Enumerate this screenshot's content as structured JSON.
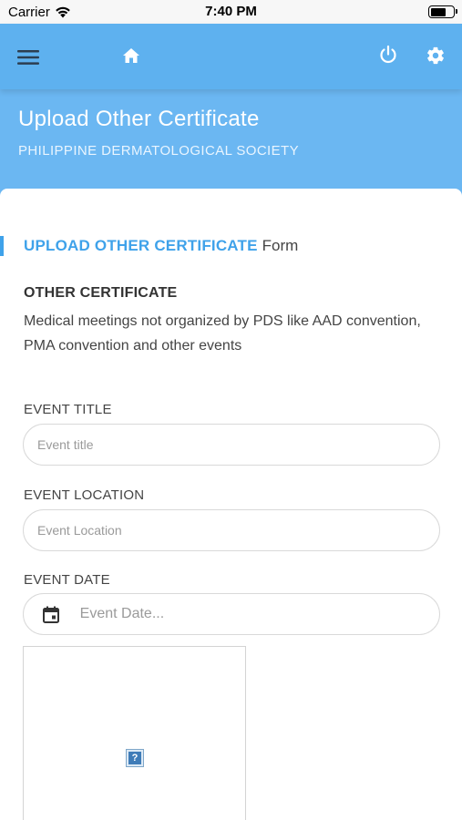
{
  "status_bar": {
    "carrier": "Carrier",
    "time": "7:40 PM"
  },
  "toolbar": {
    "icons": [
      "menu-icon",
      "home-icon",
      "power-icon",
      "gear-icon"
    ]
  },
  "header": {
    "title": "Upload Other Certificate",
    "subtitle": "PHILIPPINE DERMATOLOGICAL SOCIETY"
  },
  "form": {
    "heading_strong": "UPLOAD OTHER CERTIFICATE",
    "heading_light": "Form",
    "section_title": "OTHER CERTIFICATE",
    "section_desc": "Medical meetings not organized by PDS like AAD convention, PMA convention and other events",
    "fields": {
      "event_title": {
        "label": "EVENT TITLE",
        "placeholder": "Event title",
        "value": ""
      },
      "event_location": {
        "label": "EVENT LOCATION",
        "placeholder": "Event Location",
        "value": ""
      },
      "event_date": {
        "label": "EVENT DATE",
        "placeholder": "Event Date...",
        "value": ""
      }
    },
    "image_placeholder": "?"
  },
  "colors": {
    "accent": "#3fa2ea",
    "header": "#5eb1ef"
  }
}
